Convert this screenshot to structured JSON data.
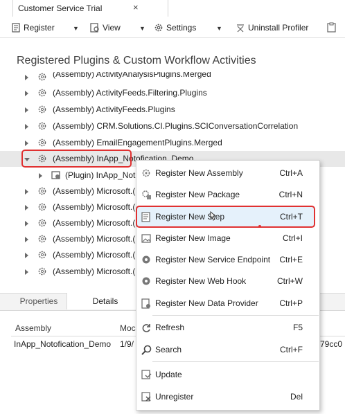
{
  "tab": {
    "title": "Customer Service Trial",
    "close_glyph": "×"
  },
  "toolbar": {
    "register": "Register",
    "view": "View",
    "settings": "Settings",
    "uninstall_profiler": "Uninstall Profiler"
  },
  "heading": "Registered Plugins & Custom Workflow Activities",
  "tree": {
    "rows": [
      {
        "label": "(Assembly) ActivityAnalysisPlugins.Merged"
      },
      {
        "label": "(Assembly) ActivityFeeds.Filtering.Plugins"
      },
      {
        "label": "(Assembly) ActivityFeeds.Plugins"
      },
      {
        "label": "(Assembly) CRM.Solutions.CI.Plugins.SCIConversationCorrelation"
      },
      {
        "label": "(Assembly) EmailEngagementPlugins.Merged"
      },
      {
        "label": "(Assembly) InApp_Notofication_Demo"
      },
      {
        "label": "(Plugin) InApp_Not"
      },
      {
        "label": "(Assembly) Microsoft.("
      },
      {
        "label": "(Assembly) Microsoft.("
      },
      {
        "label": "(Assembly) Microsoft.("
      },
      {
        "label": "(Assembly) Microsoft.("
      },
      {
        "label": "(Assembly) Microsoft.("
      },
      {
        "label": "(Assembly) Microsoft.("
      }
    ]
  },
  "bottom_tabs": {
    "properties": "Properties",
    "details": "Details"
  },
  "grid": {
    "headers": [
      "Assembly",
      "Moc"
    ],
    "row": [
      "InApp_Notofication_Demo",
      "1/9/",
      "79cc0"
    ]
  },
  "context_menu": {
    "items": [
      {
        "label": "Register New Assembly",
        "shortcut": "Ctrl+A",
        "icon": "register-assembly-icon"
      },
      {
        "label": "Register New Package",
        "shortcut": "Ctrl+N",
        "icon": "register-package-icon"
      },
      {
        "label": "Register New Step",
        "shortcut": "Ctrl+T",
        "icon": "register-step-icon"
      },
      {
        "label": "Register New Image",
        "shortcut": "Ctrl+I",
        "icon": "register-image-icon"
      },
      {
        "label": "Register New Service Endpoint",
        "shortcut": "Ctrl+E",
        "icon": "register-endpoint-icon"
      },
      {
        "label": "Register New Web Hook",
        "shortcut": "Ctrl+W",
        "icon": "register-webhook-icon"
      },
      {
        "label": "Register New Data Provider",
        "shortcut": "Ctrl+P",
        "icon": "register-dataprovider-icon"
      },
      {
        "label": "Refresh",
        "shortcut": "F5",
        "icon": "refresh-icon"
      },
      {
        "label": "Search",
        "shortcut": "Ctrl+F",
        "icon": "search-icon"
      },
      {
        "label": "Update",
        "shortcut": "",
        "icon": "update-icon"
      },
      {
        "label": "Unregister",
        "shortcut": "Del",
        "icon": "unregister-icon"
      }
    ]
  }
}
